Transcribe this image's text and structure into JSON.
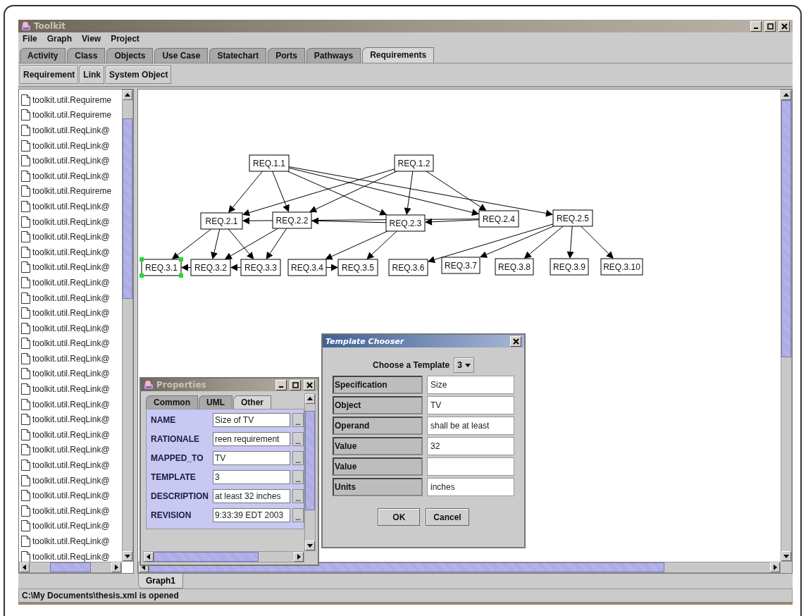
{
  "window": {
    "title": "Toolkit"
  },
  "menu": [
    "File",
    "Graph",
    "View",
    "Project"
  ],
  "tabs": [
    {
      "label": "Activity",
      "selected": false
    },
    {
      "label": "Class",
      "selected": false
    },
    {
      "label": "Objects",
      "selected": false
    },
    {
      "label": "Use Case",
      "selected": false
    },
    {
      "label": "Statechart",
      "selected": false
    },
    {
      "label": "Ports",
      "selected": false
    },
    {
      "label": "Pathways",
      "selected": false
    },
    {
      "label": "Requirements",
      "selected": true
    }
  ],
  "toolbar": [
    "Requirement",
    "Link",
    "System Object"
  ],
  "tree_items": [
    "toolkit.util.Requireme",
    "toolkit.util.Requireme",
    "toolkit.util.ReqLink@",
    "toolkit.util.ReqLink@",
    "toolkit.util.ReqLink@",
    "toolkit.util.ReqLink@",
    "toolkit.util.Requireme",
    "toolkit.util.ReqLink@",
    "toolkit.util.ReqLink@",
    "toolkit.util.ReqLink@",
    "toolkit.util.ReqLink@",
    "toolkit.util.ReqLink@",
    "toolkit.util.ReqLink@",
    "toolkit.util.ReqLink@",
    "toolkit.util.ReqLink@",
    "toolkit.util.ReqLink@",
    "toolkit.util.ReqLink@",
    "toolkit.util.ReqLink@",
    "toolkit.util.ReqLink@",
    "toolkit.util.ReqLink@",
    "toolkit.util.ReqLink@",
    "toolkit.util.ReqLink@",
    "toolkit.util.ReqLink@",
    "toolkit.util.ReqLink@",
    "toolkit.util.ReqLink@",
    "toolkit.util.ReqLink@",
    "toolkit.util.ReqLink@",
    "toolkit.util.ReqLink@",
    "toolkit.util.ReqLink@",
    "toolkit.util.ReqLink@",
    "toolkit.util.ReqLink@"
  ],
  "diagram": {
    "nodes": [
      {
        "label": "REQ.1.1",
        "selected": false
      },
      {
        "label": "REQ.1.2",
        "selected": false
      },
      {
        "label": "REQ.2.1",
        "selected": false
      },
      {
        "label": "REQ.2.2",
        "selected": false
      },
      {
        "label": "REQ.2.3",
        "selected": false
      },
      {
        "label": "REQ.2.4",
        "selected": false
      },
      {
        "label": "REQ.2.5",
        "selected": false
      },
      {
        "label": "REQ.3.1",
        "selected": true
      },
      {
        "label": "REQ.3.2",
        "selected": false
      },
      {
        "label": "REQ.3.3",
        "selected": false
      },
      {
        "label": "REQ.3.4",
        "selected": false
      },
      {
        "label": "REQ.3.5",
        "selected": false
      },
      {
        "label": "REQ.3.6",
        "selected": false
      },
      {
        "label": "REQ.3.7",
        "selected": false
      },
      {
        "label": "REQ.3.8",
        "selected": false
      },
      {
        "label": "REQ.3.9",
        "selected": false
      },
      {
        "label": "REQ.3.10",
        "selected": false
      }
    ]
  },
  "graph_tabs": [
    {
      "label": "Graph1",
      "selected": true
    }
  ],
  "properties": {
    "title": "Properties",
    "tabs": [
      {
        "label": "Common",
        "selected": false
      },
      {
        "label": "UML",
        "selected": false
      },
      {
        "label": "Other",
        "selected": true
      }
    ],
    "rows": [
      {
        "label": "NAME",
        "value": "Size of TV",
        "button": "..."
      },
      {
        "label": "RATIONALE",
        "value": "reen requirement",
        "button": "..."
      },
      {
        "label": "MAPPED_TO",
        "value": "TV",
        "button": "..."
      },
      {
        "label": "TEMPLATE",
        "value": "3",
        "button": "..."
      },
      {
        "label": "DESCRIPTION",
        "value": "at least 32 inches",
        "button": "..."
      },
      {
        "label": "REVISION",
        "value": "9:33:39 EDT 2003",
        "button": "..."
      }
    ]
  },
  "template_chooser": {
    "title": "Template Chooser",
    "prompt": "Choose a Template",
    "choice": "3",
    "rows": [
      {
        "label": "Specification",
        "value": "Size"
      },
      {
        "label": "Object",
        "value": "TV"
      },
      {
        "label": "Operand",
        "value": "shall be at least"
      },
      {
        "label": "Value",
        "value": "32"
      },
      {
        "label": "Value",
        "value": ""
      },
      {
        "label": "Units",
        "value": "inches"
      }
    ],
    "buttons": [
      "OK",
      "Cancel"
    ]
  },
  "status_bar": "C:\\My Documents\\thesis.xml is opened"
}
